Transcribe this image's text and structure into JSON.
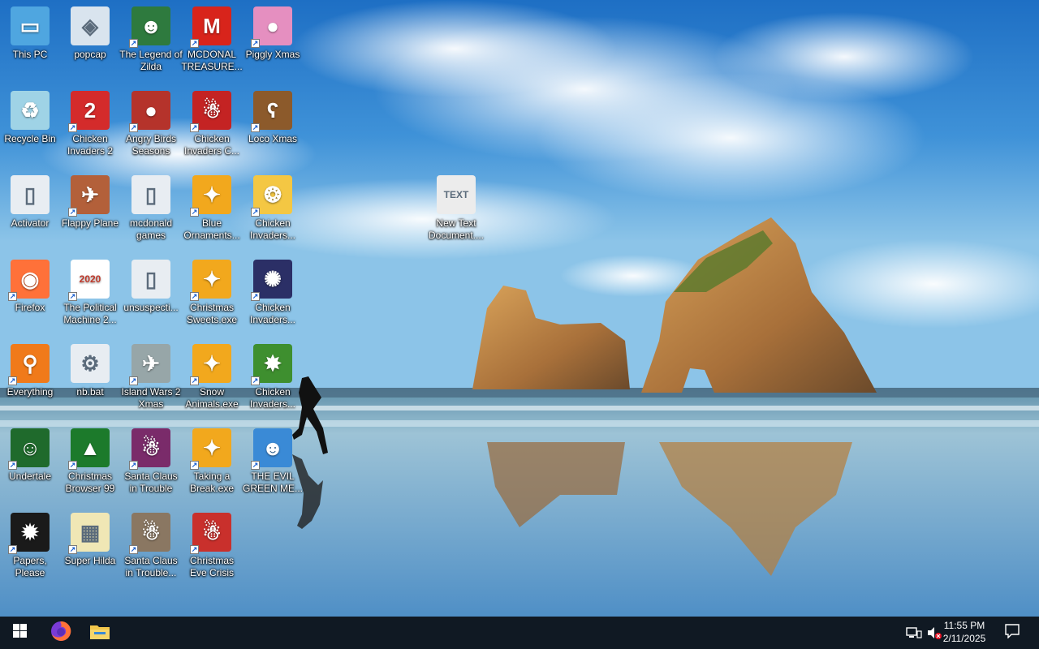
{
  "desktop": {
    "icons": [
      {
        "label": "This PC",
        "icon": "this-pc-icon",
        "glyph": "▭",
        "bg": "#4fa6e0",
        "shortcut": false
      },
      {
        "label": "popcap",
        "icon": "popcap-folder-icon",
        "glyph": "◈",
        "bg": "#d9e4ee",
        "shortcut": false
      },
      {
        "label": "The Legend of Zilda",
        "icon": "zilda-game-icon",
        "glyph": "☻",
        "bg": "#2e7a3e",
        "shortcut": true
      },
      {
        "label": "MCDONAL TREASURE...",
        "icon": "mcdonald-treasure-icon",
        "glyph": "M",
        "bg": "#d8241b",
        "shortcut": true
      },
      {
        "label": "Piggly Xmas",
        "icon": "piggly-xmas-icon",
        "glyph": "●",
        "bg": "#e58fc0",
        "shortcut": true
      },
      {
        "label": "Recycle Bin",
        "icon": "recycle-bin-icon",
        "glyph": "♻",
        "bg": "#9fd3e6",
        "shortcut": false
      },
      {
        "label": "Chicken Invaders 2",
        "icon": "chicken-invaders-2-icon",
        "glyph": "2",
        "bg": "#d42b2b",
        "shortcut": true
      },
      {
        "label": "Angry Birds Seasons",
        "icon": "angry-birds-seasons-icon",
        "glyph": "●",
        "bg": "#b5332b",
        "shortcut": true
      },
      {
        "label": "Chicken Invaders C...",
        "icon": "chicken-invaders-c-icon",
        "glyph": "☃",
        "bg": "#c42323",
        "shortcut": true
      },
      {
        "label": "Loco Xmas",
        "icon": "loco-xmas-icon",
        "glyph": "ʕ",
        "bg": "#8c5a2b",
        "shortcut": true
      },
      {
        "label": "Activator",
        "icon": "activator-file-icon",
        "glyph": "▯",
        "bg": "#e8edf2",
        "shortcut": false
      },
      {
        "label": "Flappy Plane",
        "icon": "flappy-plane-icon",
        "glyph": "✈",
        "bg": "#b3603a",
        "shortcut": true
      },
      {
        "label": "mcdonald games",
        "icon": "mcdonald-games-file-icon",
        "glyph": "▯",
        "bg": "#e8edf2",
        "shortcut": false
      },
      {
        "label": "Blue Ornaments...",
        "icon": "blue-ornaments-exe-icon",
        "glyph": "✦",
        "bg": "#f2a81d",
        "shortcut": true
      },
      {
        "label": "Chicken Invaders...",
        "icon": "chicken-invaders-3-icon",
        "glyph": "❂",
        "bg": "#f4c743",
        "shortcut": true
      },
      {
        "label": "Firefox",
        "icon": "firefox-icon",
        "glyph": "◉",
        "bg": "#ff7139",
        "shortcut": true
      },
      {
        "label": "The Political Machine 2...",
        "icon": "political-machine-icon",
        "glyph": "2020",
        "bg": "#ffffff",
        "shortcut": true
      },
      {
        "label": "unsuspecti...",
        "icon": "unsuspecting-file-icon",
        "glyph": "▯",
        "bg": "#e8edf2",
        "shortcut": false
      },
      {
        "label": "Christmas Sweets.exe",
        "icon": "christmas-sweets-exe-icon",
        "glyph": "✦",
        "bg": "#f2a81d",
        "shortcut": true
      },
      {
        "label": "Chicken Invaders...",
        "icon": "chicken-invaders-4-icon",
        "glyph": "✺",
        "bg": "#2b2f66",
        "shortcut": true
      },
      {
        "label": "Everything",
        "icon": "everything-search-icon",
        "glyph": "⚲",
        "bg": "#f07a1a",
        "shortcut": true
      },
      {
        "label": "nb.bat",
        "icon": "bat-file-gear-icon",
        "glyph": "⚙",
        "bg": "#e8edf2",
        "shortcut": false
      },
      {
        "label": "Island Wars 2 Xmas",
        "icon": "island-wars-2-icon",
        "glyph": "✈",
        "bg": "#97a6a8",
        "shortcut": true
      },
      {
        "label": "Snow Animals.exe",
        "icon": "snow-animals-exe-icon",
        "glyph": "✦",
        "bg": "#f2a81d",
        "shortcut": true
      },
      {
        "label": "Chicken Invaders...",
        "icon": "chicken-invaders-5-icon",
        "glyph": "✸",
        "bg": "#3e8f2f",
        "shortcut": true
      },
      {
        "label": "Undertale",
        "icon": "undertale-icon",
        "glyph": "☺",
        "bg": "#1f6a2c",
        "shortcut": true
      },
      {
        "label": "Christmas Browser 99",
        "icon": "christmas-browser-icon",
        "glyph": "▲",
        "bg": "#1c7a2b",
        "shortcut": true
      },
      {
        "label": "Santa Claus in Trouble",
        "icon": "santa-claus-trouble-icon",
        "glyph": "☃",
        "bg": "#7a2b6a",
        "shortcut": true
      },
      {
        "label": "Taking a Break.exe",
        "icon": "taking-a-break-exe-icon",
        "glyph": "✦",
        "bg": "#f2a81d",
        "shortcut": true
      },
      {
        "label": "THE EVIL GREEN ME...",
        "icon": "evil-green-messenger-icon",
        "glyph": "☻",
        "bg": "#3a8ad6",
        "shortcut": true
      },
      {
        "label": "Papers, Please",
        "icon": "papers-please-icon",
        "glyph": "✹",
        "bg": "#1a1a1a",
        "shortcut": true
      },
      {
        "label": "Super Hilda",
        "icon": "super-hilda-icon",
        "glyph": "▦",
        "bg": "#f0e7b5",
        "shortcut": true
      },
      {
        "label": "Santa Claus in Trouble...",
        "icon": "santa-claus-trouble-2-icon",
        "glyph": "☃",
        "bg": "#8a7762",
        "shortcut": true
      },
      {
        "label": "Christmas Eve Crisis",
        "icon": "christmas-eve-crisis-icon",
        "glyph": "☃",
        "bg": "#c9302c",
        "shortcut": true
      },
      {
        "label": "New Text Document....",
        "icon": "text-document-icon",
        "glyph": "TEXT",
        "bg": "#ececec",
        "shortcut": false
      }
    ]
  },
  "taskbar": {
    "start_icon": "windows-start-icon",
    "pinned": [
      {
        "name": "taskbar-firefox-button",
        "icon": "firefox-icon"
      },
      {
        "name": "taskbar-file-explorer-button",
        "icon": "file-explorer-icon"
      }
    ],
    "clock": {
      "time": "11:55 PM",
      "date": "2/11/2025"
    },
    "colors": {
      "taskbar_bg": "#101923",
      "accent": "#ff7139"
    }
  }
}
